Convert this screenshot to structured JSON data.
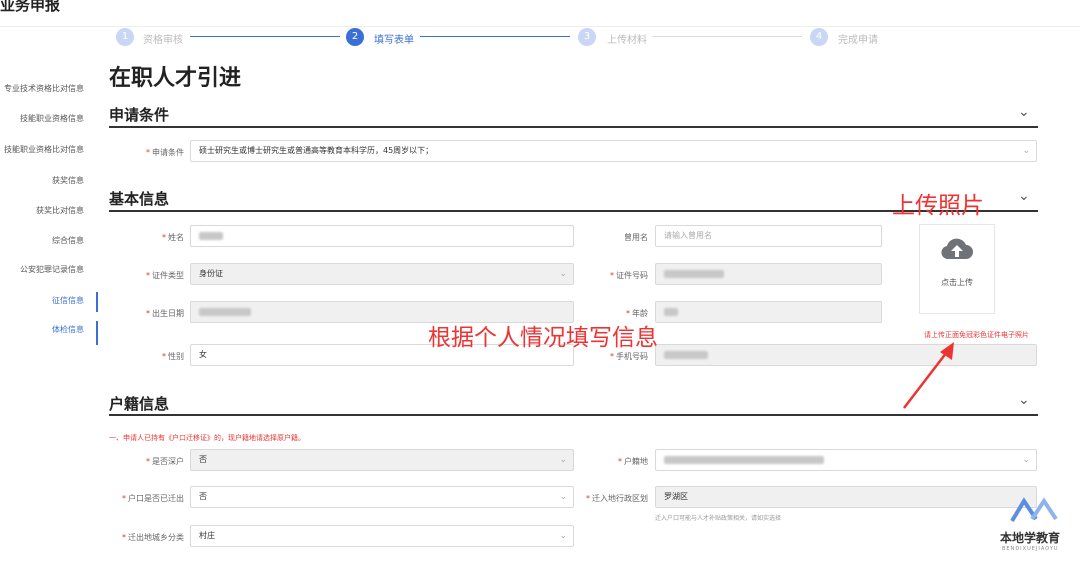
{
  "app": {
    "title": "业务申报"
  },
  "steps": [
    {
      "num": "1",
      "label": "资格审核"
    },
    {
      "num": "2",
      "label": "填写表单"
    },
    {
      "num": "3",
      "label": "上传材料"
    },
    {
      "num": "4",
      "label": "完成申请"
    }
  ],
  "sidebar": {
    "items": [
      {
        "label": "专业技术资格比对信息"
      },
      {
        "label": "技能职业资格信息"
      },
      {
        "label": "技能职业资格比对信息"
      },
      {
        "label": "获奖信息"
      },
      {
        "label": "获奖比对信息"
      },
      {
        "label": "综合信息"
      },
      {
        "label": "公安犯罪记录信息"
      },
      {
        "label": "征信信息"
      },
      {
        "label": "体检信息"
      }
    ]
  },
  "page": {
    "title": "在职人才引进"
  },
  "sections": {
    "conditions": {
      "title": "申请条件",
      "field_label": "申请条件",
      "field_value": "硕士研究生或博士研究生或普通高等教育本科学历，45周岁以下；"
    },
    "basic": {
      "title": "基本信息",
      "name_label": "姓名",
      "used_name_label": "曾用名",
      "used_name_placeholder": "请输入曾用名",
      "id_type_label": "证件类型",
      "id_type_value": "身份证",
      "id_no_label": "证件号码",
      "birth_label": "出生日期",
      "age_label": "年龄",
      "gender_label": "性别",
      "gender_value": "女",
      "phone_label": "手机号码",
      "upload_label": "点击上传",
      "upload_note": "请上传正面免冠彩色证件电子照片"
    },
    "household": {
      "title": "户籍信息",
      "notice": "一、申请人已持有《户口迁移证》的，现户籍地请选择原户籍。",
      "is_shenzhen_label": "是否深户",
      "is_shenzhen_value": "否",
      "hukou_label": "户籍地",
      "moved_out_label": "户口是否已迁出",
      "moved_out_value": "否",
      "move_in_district_label": "迁入地行政区划",
      "move_in_district_value": "罗湖区",
      "move_in_hint": "迁入户口可能与人才补贴政策相关，请如实选择",
      "urban_rural_label": "迁出地城乡分类",
      "urban_rural_value": "村庄"
    }
  },
  "annotations": {
    "upload_photo": "上传照片",
    "fill_info": "根据个人情况填写信息"
  },
  "watermark": {
    "text": "本地学教育",
    "sub": "BENDIXUEJIAOYU"
  },
  "colors": {
    "accent": "#3a6fd8",
    "annotation": "#e33333"
  }
}
